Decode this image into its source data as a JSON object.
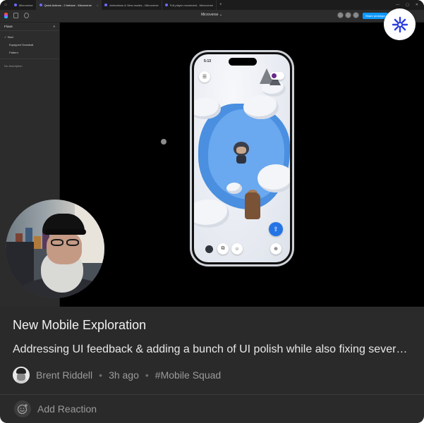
{
  "browser": {
    "tabs": [
      {
        "label": "Microverse",
        "active": false
      },
      {
        "label": "Quick Actions - 2 behave - Microverse",
        "active": true
      },
      {
        "label": "Animations & View modes - Microverse",
        "active": false
      },
      {
        "label": "Full player movement - Microverse",
        "active": false
      }
    ],
    "new_tab": "+"
  },
  "app": {
    "file_title": "Microverse ⌄",
    "share_label": "Share prototype"
  },
  "sidebar": {
    "header": "Flows",
    "close": "×",
    "section": "Start",
    "flows": [
      "Equipped Snowball",
      "Pattern"
    ],
    "description": "No description"
  },
  "phone": {
    "time": "5:13"
  },
  "post": {
    "title": "New Mobile Exploration",
    "description": "Addressing UI feedback & adding a bunch of UI polish while also fixing several issues across the mobile experience",
    "author": "Brent Riddell",
    "time_ago": "3h ago",
    "channel": "#Mobile Squad",
    "separator": "•"
  },
  "reaction": {
    "label": "Add Reaction"
  },
  "colors": {
    "card_background": "#2a2a2a",
    "accent_blue": "#0d99ff",
    "logo_blue": "#2b3fe0",
    "lake": "#4a8fe0"
  },
  "icons": {
    "badge": "sparkle-burst-icon",
    "reaction": "smiley-add-icon"
  }
}
